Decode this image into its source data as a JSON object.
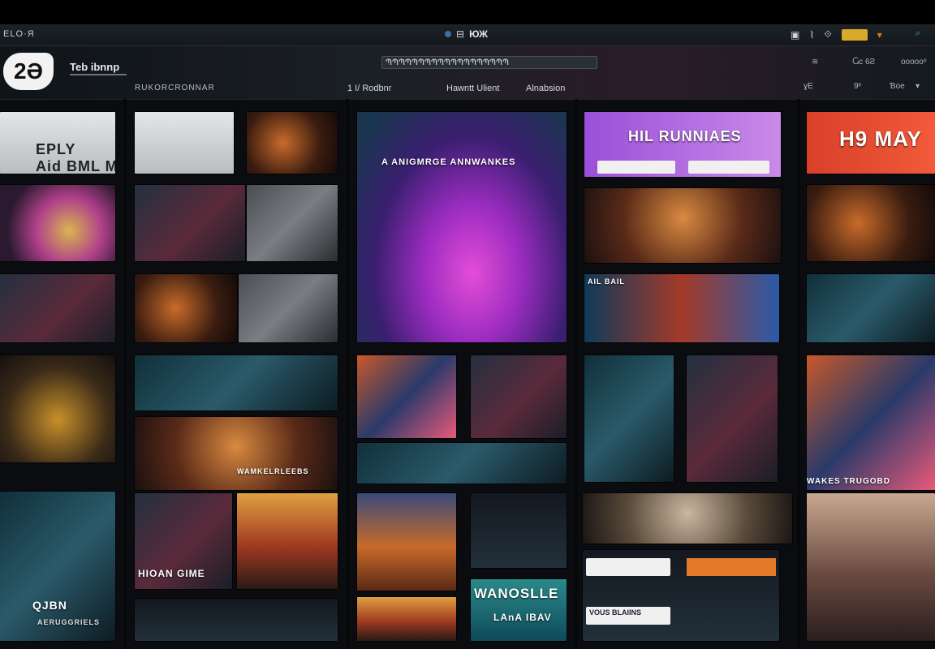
{
  "titlebar": {
    "app_title": "ELO·Я",
    "center_label": "ЮЖ",
    "center_glyph": "⊟",
    "right_icons": [
      "window-icon",
      "graph-icon",
      "link-icon",
      "badge-icon",
      "shield-icon"
    ],
    "far_glyph": "⌕"
  },
  "header": {
    "logo_text": "2Ә",
    "brand_title": "Teb ibnnp",
    "sub_left": "RUKORCRONNAR",
    "search_value": "ՊՊՊՊՊՊՊՊՊՊՊՊՊՊՊՊՊՊՊ",
    "nav": [
      "1 I/ Rodbnr",
      "Hawntt Ulient",
      "Alnabsion"
    ],
    "controls_row1": [
      "≋",
      "Ⴚc 6Ƨ",
      "oooooᵒ"
    ],
    "controls_row2": [
      "ɣE",
      "9ᵉ",
      "Ɓoe"
    ]
  },
  "tiles": {
    "c1_r1": "EPLY\nAid BML MYA",
    "c3_top": "A ANIGMRGE ANNWANKES",
    "c4_top": "HIL RUNNIAES",
    "c5_top": "H9 MAY",
    "c4_mid": "AIL BAIL",
    "c5_caption": "WAKES TRUGOBD",
    "c2_bottom": "HIOAN GIME",
    "c1_bottom": "QJBN",
    "c1_bottom_sub": "AERUGGRIELS",
    "c3_bottom": "WANOSLLE",
    "c3_bottom_sub": "LAnA IBAV",
    "c4_bar": "VOUS BLAIINS",
    "c2_caption": "WAMKELRLEEBS"
  }
}
